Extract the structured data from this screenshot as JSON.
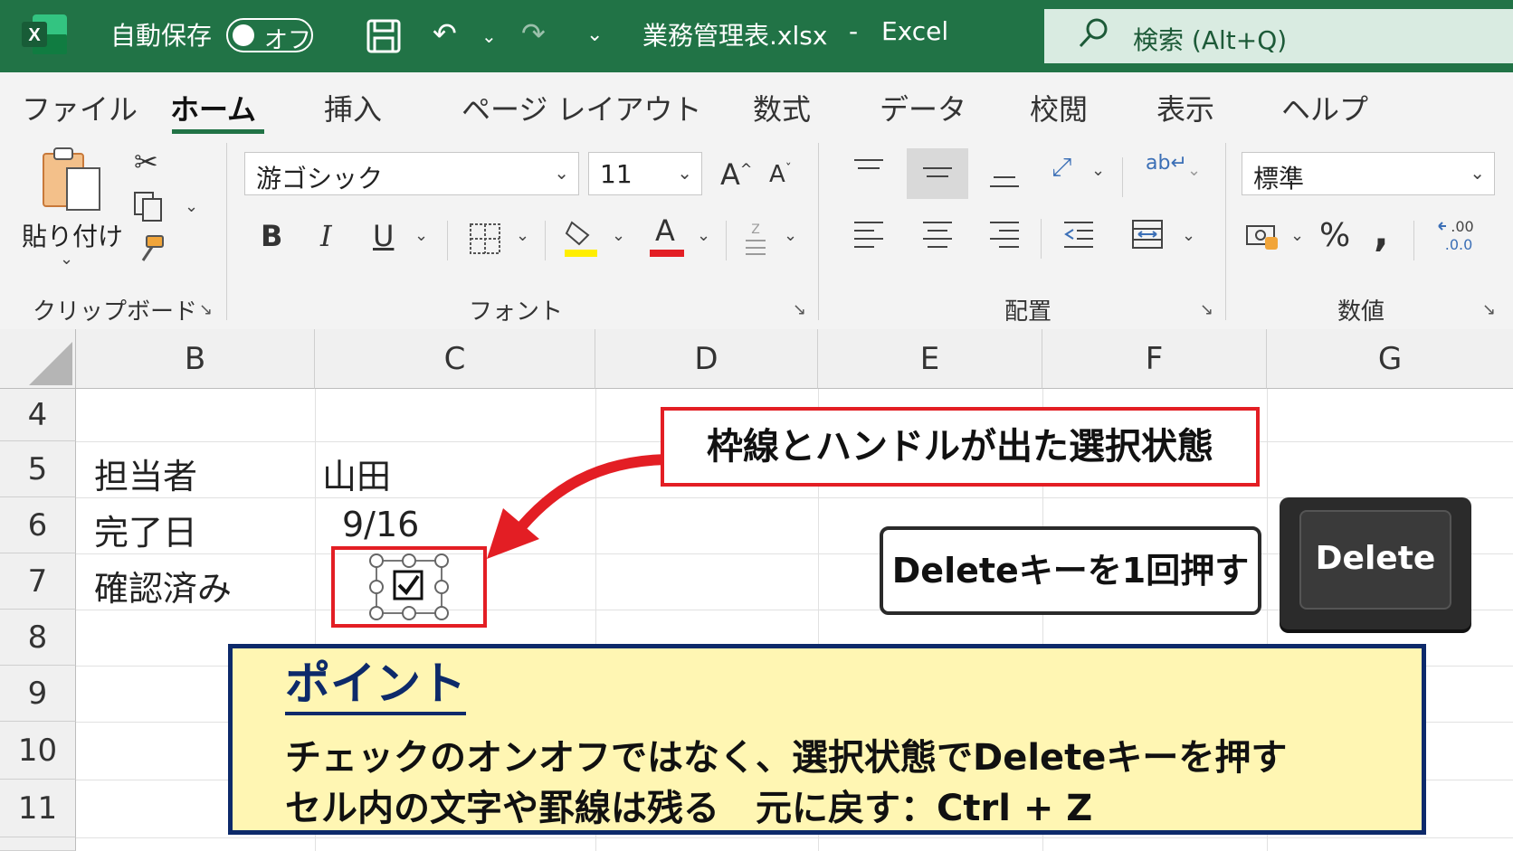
{
  "titlebar": {
    "autosave_label": "自動保存",
    "autosave_state": "オフ",
    "filename": "業務管理表.xlsx",
    "separator": "-",
    "app": "Excel",
    "search_placeholder": "検索 (Alt+Q)"
  },
  "tabs": [
    "ファイル",
    "ホーム",
    "挿入",
    "ページ レイアウト",
    "数式",
    "データ",
    "校閲",
    "表示",
    "ヘルプ"
  ],
  "active_tab": "ホーム",
  "ribbon": {
    "clipboard": {
      "paste_label": "貼り付け",
      "group_label": "クリップボード"
    },
    "font": {
      "font_name": "游ゴシック",
      "font_size": "11",
      "group_label": "フォント",
      "bold": "B",
      "italic": "I",
      "underline": "U",
      "grow": "A",
      "shrink": "A",
      "font_color_letter": "A"
    },
    "alignment": {
      "group_label": "配置"
    },
    "number": {
      "format": "標準",
      "percent": "%",
      "comma": ",",
      "group_label": "数値"
    }
  },
  "sheet": {
    "columns": [
      "B",
      "C",
      "D",
      "E",
      "F",
      "G"
    ],
    "rows": [
      "4",
      "5",
      "6",
      "7",
      "8",
      "9",
      "10",
      "11"
    ],
    "cells": {
      "B5": "担当者",
      "C5": "山田",
      "B6": "完了日",
      "C6": "9/16",
      "B7": "確認済み"
    },
    "checkbox_checked": true
  },
  "annotations": {
    "selection_callout": "枠線とハンドルが出た選択状態",
    "instruction": "Deleteキーを1回押す",
    "key_label": "Delete",
    "point_title": "ポイント",
    "point_line1": "チェックのオンオフではなく、選択状態でDeleteキーを押す",
    "point_line2": "セル内の文字や罫線は残る　元に戻す：Ctrl + Z"
  },
  "colors": {
    "excel_green": "#217346",
    "callout_red": "#e31e24",
    "point_navy": "#0d2a6a",
    "point_bg": "#fff6b3"
  }
}
